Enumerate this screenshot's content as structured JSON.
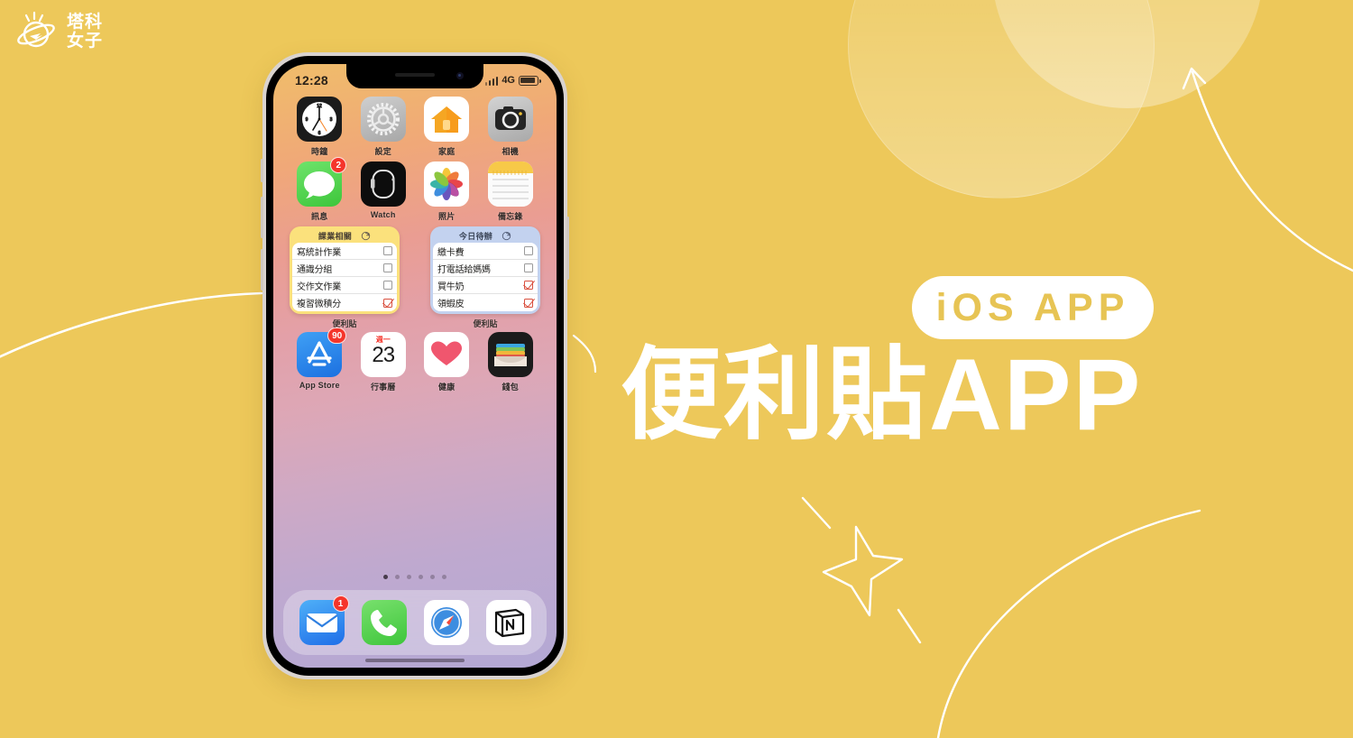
{
  "brand": {
    "logo_text_line1": "塔科",
    "logo_text_line2": "女子",
    "logo_icon": "planet-icon"
  },
  "headline": {
    "badge": "iOS APP",
    "title": "便利貼APP"
  },
  "colors": {
    "background": "#edc85a",
    "badge_text": "#e7c454",
    "headline_text": "#ffffff",
    "widget_yellow": "#fbe17c",
    "widget_blue": "#c3d2ef",
    "check_red": "#d9503f",
    "notification_red": "#f5352b"
  },
  "phone": {
    "status_bar": {
      "time": "12:28",
      "network": "4G",
      "signal_icon": "signal-bars-icon",
      "battery_icon": "battery-icon"
    },
    "app_rows": [
      {
        "apps": [
          {
            "label": "時鐘",
            "icon": "clock-icon",
            "badge": null
          },
          {
            "label": "設定",
            "icon": "settings-gear-icon",
            "badge": null
          },
          {
            "label": "家庭",
            "icon": "home-house-icon",
            "badge": null
          },
          {
            "label": "相機",
            "icon": "camera-icon",
            "badge": null
          }
        ]
      },
      {
        "apps": [
          {
            "label": "訊息",
            "icon": "messages-bubble-icon",
            "badge": "2"
          },
          {
            "label": "Watch",
            "icon": "watch-icon",
            "badge": null
          },
          {
            "label": "照片",
            "icon": "photos-flower-icon",
            "badge": null
          },
          {
            "label": "備忘錄",
            "icon": "notes-icon",
            "badge": null
          }
        ]
      }
    ],
    "widgets": [
      {
        "title": "課業相關",
        "theme": "yellow",
        "refresh_icon": "refresh-circle-icon",
        "caption": "便利貼",
        "items": [
          {
            "text": "寫統計作業",
            "checked": false
          },
          {
            "text": "通識分組",
            "checked": false
          },
          {
            "text": "交作文作業",
            "checked": false
          },
          {
            "text": "複習微積分",
            "checked": true
          }
        ]
      },
      {
        "title": "今日待辦",
        "theme": "blue",
        "refresh_icon": "refresh-circle-icon",
        "caption": "便利貼",
        "items": [
          {
            "text": "繳卡費",
            "checked": false
          },
          {
            "text": "打電話給媽媽",
            "checked": false
          },
          {
            "text": "買牛奶",
            "checked": true
          },
          {
            "text": "領蝦皮",
            "checked": true
          }
        ]
      }
    ],
    "bottom_row": {
      "apps": [
        {
          "label": "App Store",
          "icon": "app-store-icon",
          "badge": "90"
        },
        {
          "label": "行事曆",
          "icon": "calendar-icon",
          "badge": null,
          "weekday": "週一",
          "day": "23"
        },
        {
          "label": "健康",
          "icon": "health-heart-icon",
          "badge": null
        },
        {
          "label": "錢包",
          "icon": "wallet-icon",
          "badge": null
        }
      ]
    },
    "page_dots": {
      "count": 6,
      "active_index": 0
    },
    "dock": {
      "apps": [
        {
          "label": "Mail",
          "icon": "mail-envelope-icon",
          "badge": "1"
        },
        {
          "label": "Phone",
          "icon": "phone-handset-icon",
          "badge": null
        },
        {
          "label": "Safari",
          "icon": "safari-compass-icon",
          "badge": null
        },
        {
          "label": "Notion",
          "icon": "notion-icon",
          "badge": null
        }
      ]
    }
  },
  "decorations": {
    "circle_large": "translucent-circle",
    "circle_small": "translucent-circle",
    "arrow": "curved-arrow-icon",
    "star": "four-point-star-icon",
    "curve_left": "curved-line"
  }
}
